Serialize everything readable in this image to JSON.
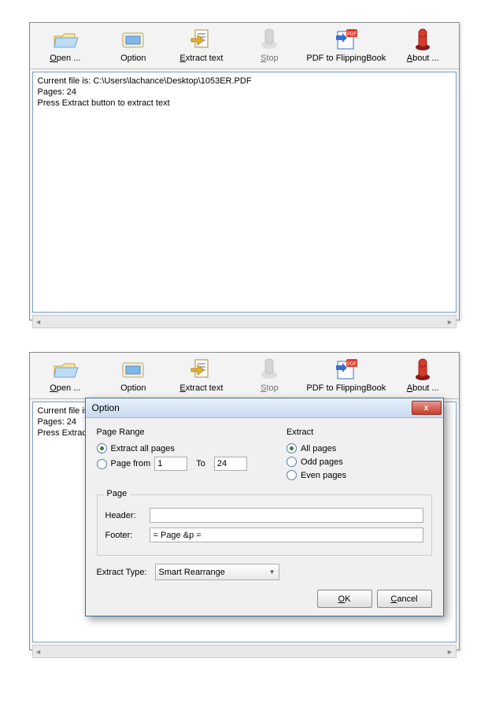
{
  "toolbar": {
    "open": "Open ...",
    "option": "Option",
    "extract": "Extract text",
    "stop": "Stop",
    "pdf2fb": "PDF to FlippingBook",
    "about": "About ..."
  },
  "content": {
    "line1": "Current file is: C:\\Users\\lachance\\Desktop\\1053ER.PDF",
    "line2": "Pages: 24",
    "line3": "Press Extract button to extract text"
  },
  "content2": {
    "line1": "Current file is: C",
    "line2": "Pages: 24",
    "line3": "Press Extract b"
  },
  "dialog": {
    "title": "Option",
    "close": "x",
    "page_range_label": "Page Range",
    "extract_all_pages": "Extract all pages",
    "page_from": "Page from",
    "from_value": "1",
    "to_label": "To",
    "to_value": "24",
    "extract_label": "Extract",
    "all_pages": "All pages",
    "odd_pages": "Odd pages",
    "even_pages": "Even pages",
    "page_label": "Page",
    "header_label": "Header:",
    "header_value": "",
    "footer_label": "Footer:",
    "footer_value": "= Page &p =",
    "extract_type_label": "Extract Type:",
    "extract_type_value": "Smart Rearrange",
    "ok": "OK",
    "cancel": "Cancel"
  }
}
